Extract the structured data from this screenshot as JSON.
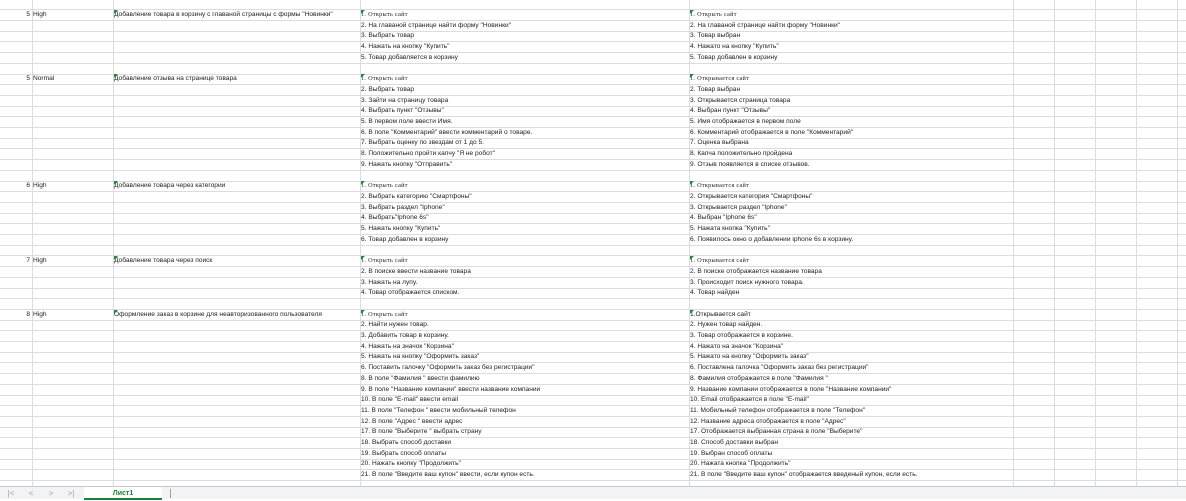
{
  "sheet": {
    "tab_name": "Лист1",
    "nav_icons": [
      "first-sheet-icon",
      "prev-sheet-icon",
      "next-sheet-icon",
      "last-sheet-icon"
    ],
    "flag_color": "#1e8e3e",
    "tab_color": "#188038"
  },
  "rows": [
    {
      "num": "5",
      "prio": "High",
      "title": "Добавление товара в корзину с главаной страницы с формы \"Новинки\"",
      "step": "1.   Открыть  сайт",
      "exp": "1.   Открыть  сайт",
      "serif": true
    },
    {
      "step": "2. На главаной странице найти форму \"Новинки\"",
      "exp": "2. На главаной странице найти форму \"Новинки\""
    },
    {
      "step": "3. Выбрать товар",
      "exp": "3. Товар выбран"
    },
    {
      "step": "4. Нажать на кнопку \"Купить\"",
      "exp": "4. Нажато на кнопку \"Купить\""
    },
    {
      "step": "5. Товар добавляется в корзину",
      "exp": "5. Товар добавлен  в корзину"
    },
    {},
    {
      "num": "5",
      "prio": "Normal",
      "title": "Добавление отзыва на странице товара",
      "step": "1.   Открыть  сайт",
      "exp": "1.   Открывается  сайт",
      "serif": true
    },
    {
      "step": "2. Выбрать товар",
      "exp": "2. Товар выбран"
    },
    {
      "step": "3. Зайти на страницу товара",
      "exp": "3. Открывается страница товара"
    },
    {
      "step": "4. Выбрать пункт \"Отзывы\"",
      "exp": "4. Выбран пункт \"Отзывы\""
    },
    {
      "step": "5. В первом поле ввести Имя.",
      "exp": "5. Имя отображается в первом поле"
    },
    {
      "step": "6. В поле \"Комментарий\" ввести комментарий о товаре.",
      "exp": "6. Комментарий отображается в поле \"Комментарий\""
    },
    {
      "step": "7. Выбрать оценку по звездам от 1 до 5.",
      "exp": "7. Оценка выбрана"
    },
    {
      "step": "8. Положительно пройти капчу \"Я не робот\"",
      "exp": "8. Капча положительно пройдена"
    },
    {
      "step": "9. Нажать кнопку \"Отправить\"",
      "exp": "9. Отзыв появляется в списке отзывов."
    },
    {},
    {
      "num": "6",
      "prio": "High",
      "title": "Добавление товара через категории",
      "step": "1.   Открыть  сайт",
      "exp": "1.   Открывается  сайт",
      "serif": true
    },
    {
      "step": "2. Выбрать категорию \"Смартфоны\"",
      "exp": "2. Открывается категория \"Смартфоны\""
    },
    {
      "step": "3. Выбрать раздел \"Iphone\"",
      "exp": "3. Открывается раздел \"Iphone\""
    },
    {
      "step": "4. Выбрать\"Iphone 6s\"",
      "exp": "4. Выбран \"Iphone 6s\""
    },
    {
      "step": "5. Нажать кнопку \"Купить\"",
      "exp": "5. Нажата кнопка \"Купить\""
    },
    {
      "step": "6. Товар добавлен в корзину",
      "exp": "6. Появилось окно о добавлении iphone 6s в корзину."
    },
    {},
    {
      "num": "7",
      "prio": "High",
      "title": "Добавление товара через поиск",
      "step": "1.   Открыть  сайт",
      "exp": "1.   Открывается  сайт",
      "serif": true
    },
    {
      "step": "2. В поиске ввести название товара",
      "exp": "2. В поиске отображается название товара"
    },
    {
      "step": "3. Нажать на лупу.",
      "exp": "3. Происходит поиск нужного товара."
    },
    {
      "step": "4. Товар отображается списком.",
      "exp": "4. Товар найден"
    },
    {},
    {
      "num": "8",
      "prio": "High",
      "title": "Оформление заказ в корзине для неавторизованного пользователя",
      "step": "1.   Открыть  сайт",
      "exp": "1.Открывается сайт",
      "serif": true,
      "serifOnlyStep": true
    },
    {
      "step": "2. Найти нужен товар.",
      "exp": "2. Нужен товар найден."
    },
    {
      "step": "3. Добавить товар в корзину.",
      "exp": "3. Товар отображается в корзине."
    },
    {
      "step": "4. Нажать на значок \"Корзина\"",
      "exp": "4. Нажато на значок \"Корзина\""
    },
    {
      "step": "5. Нажать на кнопку \"Оформить заказ\"",
      "exp": "5. Нажато на кнопку \"Оформить заказ\""
    },
    {
      "step": "6. Поставить галочку \"Оформить заказ без регистрации\"",
      "exp": "6. Поставлена галочка \"Оформить заказ без регистрации\""
    },
    {
      "step": "8. В поле \"Фамилия \" ввести фамилию",
      "exp": "8. Фамилия отображается в поле  \"Фамилия \""
    },
    {
      "step": "9. В поле \"Название компании\" ввести название компании",
      "exp": "9.  Название компании отображается в поле \"Название компании\""
    },
    {
      "step": "10. В поле \"E-mail\" ввести email",
      "exp": "10. Email отображается в  поле \"E-mail\""
    },
    {
      "step": "11. В поле \"Телефон \" ввести  мобильный телефон",
      "exp": "11. Мобильный телефон отображается  в поле \"Телефон\""
    },
    {
      "step": "12. В поле \"Адрес \" ввести адрес",
      "exp": "12. Название адреса отображается  в поле \"Адрес\""
    },
    {
      "step": "17. В поле \"Выберите \" выбрать страну",
      "exp": "17. Отображается выбранная страна в поле \"Выберите\""
    },
    {
      "step": "18. Выбрать способ доставки",
      "exp": "18. Способ доставки выбран"
    },
    {
      "step": "19. Выбрать способ оплаты",
      "exp": "19. Выбран способ оплаты"
    },
    {
      "step": "20. Нажать кнопку \"Продолжить\"",
      "exp": "20. Нажата кнопка \"Продолжить\""
    },
    {
      "step": "21. В поле \"Введите ваш купон\" ввести, если купон есть.",
      "exp": "21. В поле \"Введите ваш купон\" отображается введеный купон, если  есть."
    }
  ]
}
